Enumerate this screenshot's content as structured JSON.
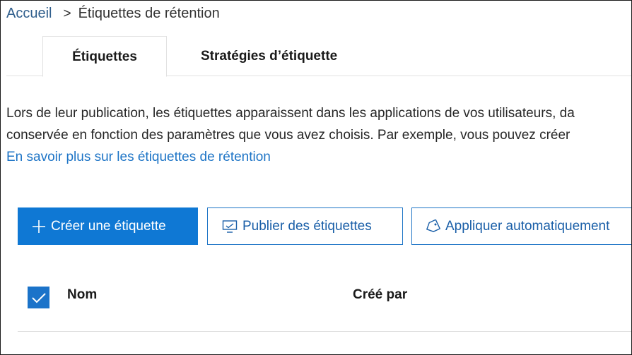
{
  "breadcrumb": {
    "home": "Accueil",
    "separator": ">",
    "current": "Étiquettes de rétention"
  },
  "tabs": [
    {
      "label": "Étiquettes",
      "active": true
    },
    {
      "label": "Stratégies d’étiquette",
      "active": false
    }
  ],
  "description": {
    "line1": "Lors de leur publication, les étiquettes apparaissent dans les applications de vos utilisateurs, da",
    "line2": "conservée en fonction des paramètres que vous avez choisis. Par exemple, vous pouvez créer",
    "link": "En savoir plus sur les étiquettes de rétention"
  },
  "toolbar": {
    "create": {
      "label": "Créer une étiquette",
      "icon": "plus-icon"
    },
    "publish": {
      "label": "Publier des étiquettes",
      "icon": "publish-icon"
    },
    "auto_apply": {
      "label": "Appliquer automatiquement",
      "icon": "tag-icon"
    }
  },
  "table": {
    "select_all_checked": true,
    "columns": [
      "Nom",
      "Créé par"
    ]
  },
  "colors": {
    "accent": "#0f78d4",
    "link": "#1d74c6",
    "breadcrumb_link": "#2f5e8c"
  }
}
